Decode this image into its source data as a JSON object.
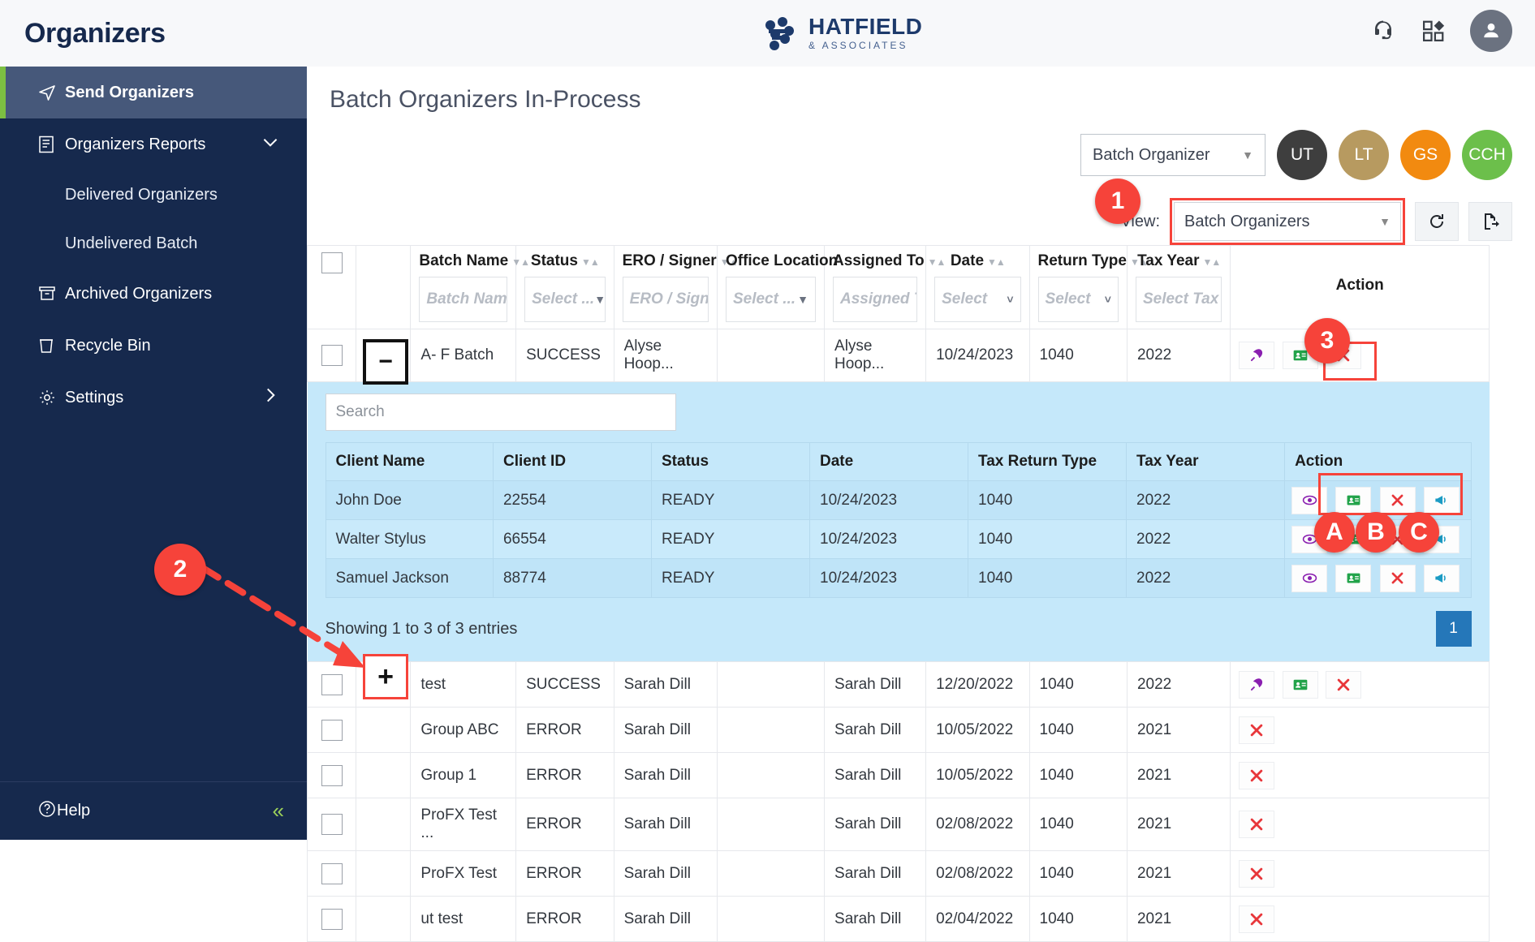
{
  "app": {
    "title": "Organizers",
    "logo_main": "HATFIELD",
    "logo_sub": "& ASSOCIATES"
  },
  "header_icons": {
    "support": "headset-icon",
    "apps": "apps-grid-icon",
    "account": "user-avatar-icon"
  },
  "sidebar": {
    "items": [
      {
        "label": "Send Organizers",
        "icon": "send-plane-icon",
        "active": true
      },
      {
        "label": "Organizers Reports",
        "icon": "report-document-icon",
        "active": false,
        "chevron": "chevron-down-icon"
      },
      {
        "label": "Delivered Organizers",
        "icon": "",
        "sub": true
      },
      {
        "label": "Undelivered Batch",
        "icon": "",
        "sub": true
      },
      {
        "label": "Archived Organizers",
        "icon": "archive-box-icon"
      },
      {
        "label": "Recycle Bin",
        "icon": "trash-bin-icon"
      },
      {
        "label": "Settings",
        "icon": "gear-icon",
        "chevron": "chevron-right-icon"
      }
    ],
    "help": {
      "label": "Help",
      "icon": "question-circle-icon",
      "collapse": "chevrons-left-icon"
    }
  },
  "page": {
    "title": "Batch Organizers In-Process"
  },
  "toolbar": {
    "batch_select_value": "Batch Organizer",
    "pills": [
      {
        "label": "UT",
        "color": "#3e3e3e"
      },
      {
        "label": "LT",
        "color": "#b79a60"
      },
      {
        "label": "GS",
        "color": "#f28a10"
      },
      {
        "label": "CCH",
        "color": "#6cbf4b"
      }
    ],
    "view_label": "View:",
    "view_value": "Batch Organizers",
    "refresh_icon": "refresh-icon",
    "export_icon": "export-file-icon"
  },
  "table": {
    "columns": [
      {
        "label": "Batch Name",
        "placeholder": "Batch Name",
        "type": "text"
      },
      {
        "label": "Status",
        "placeholder": "Select ...",
        "type": "select"
      },
      {
        "label": "ERO / Signer",
        "placeholder": "ERO / Signer",
        "type": "text"
      },
      {
        "label": "Office Location",
        "placeholder": "Select ...",
        "type": "select"
      },
      {
        "label": "Assigned To",
        "placeholder": "Assigned To",
        "type": "text"
      },
      {
        "label": "Date",
        "placeholder": "Select",
        "type": "select"
      },
      {
        "label": "Return Type",
        "placeholder": "Select",
        "type": "select"
      },
      {
        "label": "Tax Year",
        "placeholder": "Select Tax Year...",
        "type": "select"
      },
      {
        "label": "Action",
        "placeholder": "",
        "type": "none"
      }
    ],
    "rows": [
      {
        "expander": "−",
        "batch_name": "A- F Batch",
        "status": "SUCCESS",
        "ero_signer": "Alyse Hoop...",
        "office_location": "",
        "assigned_to": "Alyse Hoop...",
        "date": "10/24/2023",
        "return_type": "1040",
        "tax_year": "2022",
        "actions": [
          "rocket-icon",
          "contact-card-icon",
          "delete-x-icon"
        ]
      },
      {
        "expander": "+",
        "batch_name": "test",
        "status": "SUCCESS",
        "ero_signer": "Sarah Dill",
        "office_location": "",
        "assigned_to": "Sarah Dill",
        "date": "12/20/2022",
        "return_type": "1040",
        "tax_year": "2022",
        "actions": [
          "rocket-icon",
          "contact-card-icon",
          "delete-x-icon"
        ]
      },
      {
        "expander": "",
        "batch_name": "Group ABC",
        "status": "ERROR",
        "ero_signer": "Sarah Dill",
        "office_location": "",
        "assigned_to": "Sarah Dill",
        "date": "10/05/2022",
        "return_type": "1040",
        "tax_year": "2021",
        "actions": [
          "delete-x-icon"
        ]
      },
      {
        "expander": "",
        "batch_name": "Group 1",
        "status": "ERROR",
        "ero_signer": "Sarah Dill",
        "office_location": "",
        "assigned_to": "Sarah Dill",
        "date": "10/05/2022",
        "return_type": "1040",
        "tax_year": "2021",
        "actions": [
          "delete-x-icon"
        ]
      },
      {
        "expander": "",
        "batch_name": "ProFX Test ...",
        "status": "ERROR",
        "ero_signer": "Sarah Dill",
        "office_location": "",
        "assigned_to": "Sarah Dill",
        "date": "02/08/2022",
        "return_type": "1040",
        "tax_year": "2021",
        "actions": [
          "delete-x-icon"
        ]
      },
      {
        "expander": "",
        "batch_name": "ProFX Test",
        "status": "ERROR",
        "ero_signer": "Sarah Dill",
        "office_location": "",
        "assigned_to": "Sarah Dill",
        "date": "02/08/2022",
        "return_type": "1040",
        "tax_year": "2021",
        "actions": [
          "delete-x-icon"
        ]
      },
      {
        "expander": "",
        "batch_name": "ut test",
        "status": "ERROR",
        "ero_signer": "Sarah Dill",
        "office_location": "",
        "assigned_to": "Sarah Dill",
        "date": "02/04/2022",
        "return_type": "1040",
        "tax_year": "2021",
        "actions": [
          "delete-x-icon"
        ]
      }
    ]
  },
  "sub_table": {
    "search_placeholder": "Search",
    "columns": [
      "Client Name",
      "Client ID",
      "Status",
      "Date",
      "Tax Return Type",
      "Tax Year",
      "Action"
    ],
    "rows": [
      {
        "client_name": "John Doe",
        "client_id": "22554",
        "status": "READY",
        "date": "10/24/2023",
        "tax_return_type": "1040",
        "tax_year": "2022",
        "actions": [
          "preview-eye-icon",
          "contact-card-icon",
          "delete-x-icon",
          "megaphone-icon"
        ]
      },
      {
        "client_name": "Walter Stylus",
        "client_id": "66554",
        "status": "READY",
        "date": "10/24/2023",
        "tax_return_type": "1040",
        "tax_year": "2022",
        "actions": [
          "preview-eye-icon",
          "contact-card-icon",
          "delete-x-icon",
          "megaphone-icon"
        ]
      },
      {
        "client_name": "Samuel Jackson",
        "client_id": "88774",
        "status": "READY",
        "date": "10/24/2023",
        "tax_return_type": "1040",
        "tax_year": "2022",
        "actions": [
          "preview-eye-icon",
          "contact-card-icon",
          "delete-x-icon",
          "megaphone-icon"
        ]
      }
    ],
    "footer_text": "Showing 1 to 3 of 3 entries",
    "page_number": "1"
  },
  "annotations": {
    "markers": [
      {
        "id": "1",
        "target": "view-dropdown"
      },
      {
        "id": "2",
        "target": "expand-plus-button"
      },
      {
        "id": "3",
        "target": "rocket-action-button"
      },
      {
        "id": "A",
        "target": "preview-eye-icon"
      },
      {
        "id": "B",
        "target": "contact-card-icon"
      },
      {
        "id": "C",
        "target": "delete-x-icon"
      }
    ],
    "accent_color": "#f6433a"
  }
}
